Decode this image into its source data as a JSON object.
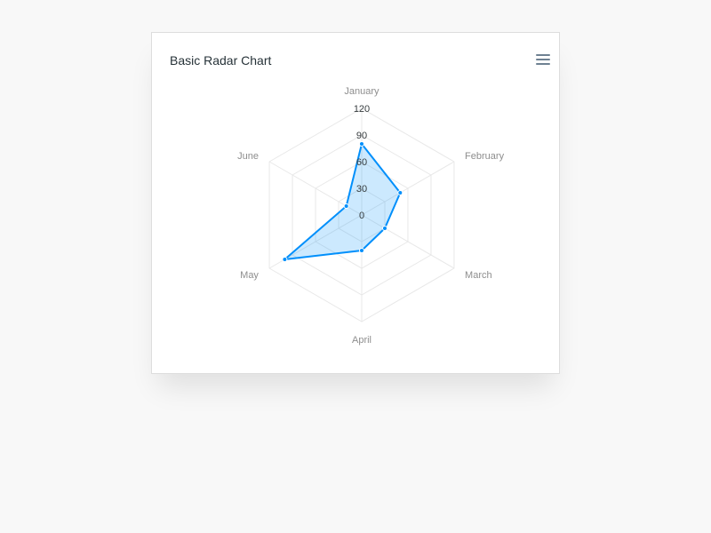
{
  "chart": {
    "title": "Basic Radar Chart",
    "menu_icon": "hamburger-menu-icon",
    "accent_color": "#008ffb"
  },
  "chart_data": {
    "type": "radar",
    "title": "Basic Radar Chart",
    "categories": [
      "January",
      "February",
      "March",
      "April",
      "May",
      "June"
    ],
    "series": [
      {
        "values": [
          80,
          50,
          30,
          40,
          100,
          20
        ]
      }
    ],
    "yaxis": {
      "min": 0,
      "max": 120,
      "ticks": [
        "0",
        "30",
        "60",
        "90",
        "120"
      ]
    },
    "grid": true,
    "colors": {
      "series": "#008ffb",
      "grid": "#e8e8e8"
    }
  }
}
